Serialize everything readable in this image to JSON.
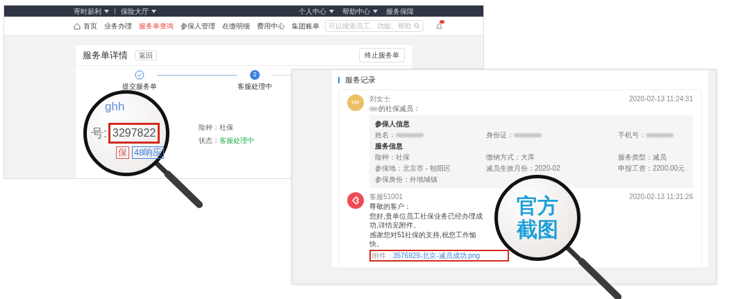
{
  "back_window": {
    "top_bar": {
      "left": [
        {
          "label": "寄时新利",
          "dropdown": true
        },
        {
          "label": "保险大厅",
          "dropdown": true
        }
      ],
      "right": [
        {
          "label": "个人中心",
          "dropdown": true
        },
        {
          "label": "帮助中心",
          "dropdown": true
        },
        {
          "label": "服务保障",
          "dropdown": false
        }
      ]
    },
    "nav": {
      "items": [
        {
          "label": "首页",
          "selected": false,
          "kind": "home"
        },
        {
          "label": "业务办理",
          "selected": false,
          "kind": "plain"
        },
        {
          "label": "服务单查询",
          "selected": true,
          "kind": "plain"
        },
        {
          "label": "参保人管理",
          "selected": false,
          "kind": "plain"
        },
        {
          "label": "在缴明细",
          "selected": false,
          "kind": "plain"
        },
        {
          "label": "费用中心",
          "selected": false,
          "kind": "plain"
        },
        {
          "label": "集团账单",
          "selected": false,
          "kind": "plain"
        }
      ],
      "search": {
        "placeholder": "可以搜索员工、功能、帮助"
      },
      "notification_badge": true
    },
    "card": {
      "title": "服务单详情",
      "back_button": "返回",
      "stop_button": "终止服务单",
      "steps": [
        {
          "label": "提交服务单",
          "completed": true
        },
        {
          "label": "客服处理中",
          "completed": false,
          "number": "2"
        }
      ],
      "fields": [
        {
          "label": "险种：",
          "value": "社保",
          "kind": "plain"
        },
        {
          "label": "状态：",
          "value": "客服处理中",
          "kind": "status"
        }
      ]
    },
    "magnifier": {
      "fragment": "ghh",
      "number_label": "号:",
      "order_number": "3297822",
      "tags": [
        {
          "label": "保",
          "color": "#e05555"
        },
        {
          "label": "48响应",
          "color": "#3b82e0"
        }
      ]
    }
  },
  "front_window": {
    "section_title": "服务记录",
    "records": [
      {
        "kind": "customer",
        "avatar": "HR",
        "author": "刘女士",
        "time": "2020-02-13 11:24:31",
        "intro": "的社保减员：",
        "intro_redacted": true,
        "sections": [
          {
            "heading": "参保人信息",
            "fields": [
              {
                "label": "姓名：",
                "redacted": true
              },
              {
                "label": "身份证：",
                "redacted": true
              },
              {
                "label": "手机号：",
                "redacted": true
              }
            ]
          },
          {
            "heading": "服务信息",
            "fields": [
              {
                "label": "险种：",
                "value": "社保",
                "redacted": false
              },
              {
                "label": "缴纳方式：",
                "value": "大库",
                "redacted": false
              },
              {
                "label": "服务类型：",
                "value": "减员",
                "redacted": false
              },
              {
                "label": "参保地：",
                "value": "北京市 - 朝阳区",
                "redacted": false
              },
              {
                "label": "减员生效月份：",
                "value": "2020-02",
                "redacted": false
              },
              {
                "label": "申报工资：",
                "value": "2200.00元",
                "redacted": false
              },
              {
                "label": "参保身份：",
                "value": "外地城镇",
                "redacted": false
              }
            ]
          }
        ]
      },
      {
        "kind": "agent",
        "author": "客服51001",
        "time": "2020-02-13 11:31:26",
        "lines": [
          "尊敬的客户：",
          "您好,贵单位员工社保业务已经办理成功,详情见附件。",
          "感谢您对51社保的支持,祝您工作愉快。"
        ],
        "attachment": {
          "label": "附件：",
          "file": "3576929-北京-减员成功.png",
          "highlighted": true
        }
      }
    ]
  },
  "magnifier": {
    "lines": [
      "官方",
      "截图"
    ]
  }
}
